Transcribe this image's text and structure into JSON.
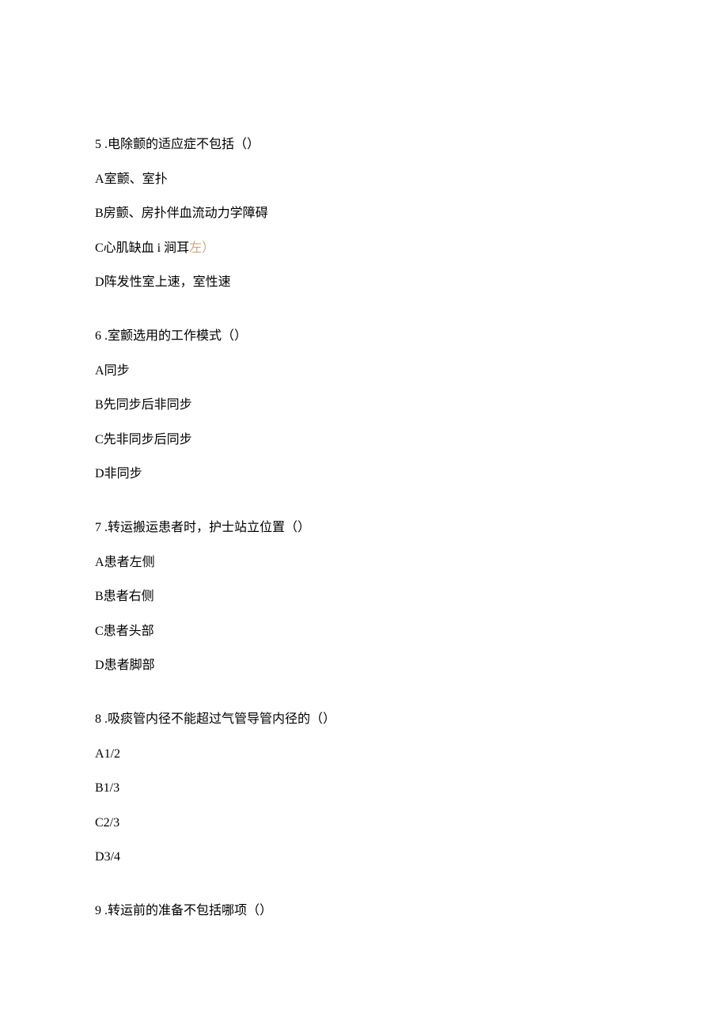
{
  "questions": [
    {
      "number": "5",
      "stem_sep": " .",
      "stem": "电除颤的适应症不包括（）",
      "options": [
        {
          "label": "A",
          "text": "室颤、室扑"
        },
        {
          "label": "B",
          "text": "房颤、房扑伴血流动力学障碍"
        },
        {
          "label": "C",
          "text": "心肌缺血 i 涧耳",
          "highlight": "左）"
        },
        {
          "label": "D",
          "text": "阵发性室上速，室性速"
        }
      ]
    },
    {
      "number": "6",
      "stem_sep": " .",
      "stem": "室颤选用的工作模式（）",
      "options": [
        {
          "label": "A",
          "text": "同步"
        },
        {
          "label": "B",
          "text": "先同步后非同步"
        },
        {
          "label": "C",
          "text": "先非同步后同步"
        },
        {
          "label": "D",
          "text": "非同步"
        }
      ]
    },
    {
      "number": "7",
      "stem_sep": " .",
      "stem": "转运搬运患者时，护士站立位置（）",
      "options": [
        {
          "label": "A",
          "text": "患者左侧"
        },
        {
          "label": "B",
          "text": "患者右侧"
        },
        {
          "label": "C",
          "text": "患者头部"
        },
        {
          "label": "D",
          "text": "患者脚部"
        }
      ]
    },
    {
      "number": "8",
      "stem_sep": " .",
      "stem": "吸痰管内径不能超过气管导管内径的（）",
      "options": [
        {
          "label": "A",
          "text": "1/2"
        },
        {
          "label": "B",
          "text": "1/3"
        },
        {
          "label": "C",
          "text": "2/3"
        },
        {
          "label": "D",
          "text": "3/4"
        }
      ]
    },
    {
      "number": "9",
      "stem_sep": " .",
      "stem": "转运前的准备不包括哪项（）",
      "options": []
    }
  ]
}
